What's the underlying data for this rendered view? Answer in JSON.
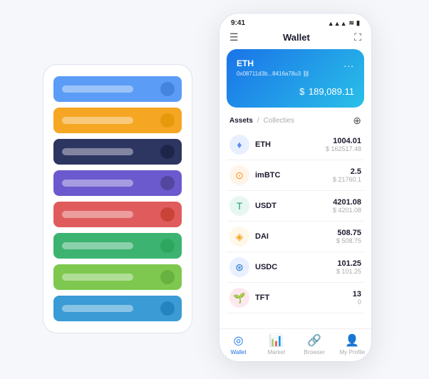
{
  "page": {
    "background": "#f5f7fa"
  },
  "card_stack": {
    "cards": [
      {
        "color": "#5b9cf6",
        "dot_color": "#3a7bd5"
      },
      {
        "color": "#f5a623",
        "dot_color": "#e09400"
      },
      {
        "color": "#2d3561",
        "dot_color": "#1a2040"
      },
      {
        "color": "#6a5acd",
        "dot_color": "#483d8b"
      },
      {
        "color": "#e05c5c",
        "dot_color": "#c0392b"
      },
      {
        "color": "#3cb371",
        "dot_color": "#27a15a"
      },
      {
        "color": "#7ec850",
        "dot_color": "#5fa83a"
      },
      {
        "color": "#3a9bd5",
        "dot_color": "#1a7ab5"
      }
    ]
  },
  "phone": {
    "status_bar": {
      "time": "9:41",
      "signal": "▲▲▲",
      "wifi": "WiFi",
      "battery": "🔋"
    },
    "nav": {
      "menu_icon": "☰",
      "title": "Wallet",
      "scan_icon": "⛶"
    },
    "eth_card": {
      "label": "ETH",
      "dots": "...",
      "address": "0x08711d3b...8416a78u3  ⛓",
      "currency": "$",
      "amount": "189,089.11"
    },
    "assets": {
      "active_tab": "Assets",
      "separator": "/",
      "inactive_tab": "Collecties",
      "add_icon": "⊕",
      "items": [
        {
          "name": "ETH",
          "icon": "♦",
          "icon_bg": "#e8f0ff",
          "icon_color": "#5b8def",
          "amount": "1004.01",
          "usd": "$ 162517.48"
        },
        {
          "name": "imBTC",
          "icon": "⊙",
          "icon_bg": "#fff4e8",
          "icon_color": "#f7931a",
          "amount": "2.5",
          "usd": "$ 21760.1"
        },
        {
          "name": "USDT",
          "icon": "T",
          "icon_bg": "#e6f7f0",
          "icon_color": "#26a17b",
          "amount": "4201.08",
          "usd": "$ 4201.08"
        },
        {
          "name": "DAI",
          "icon": "◈",
          "icon_bg": "#fff8e8",
          "icon_color": "#f5a623",
          "amount": "508.75",
          "usd": "$ 508.75"
        },
        {
          "name": "USDC",
          "icon": "⊛",
          "icon_bg": "#e8f0ff",
          "icon_color": "#2775ca",
          "amount": "101.25",
          "usd": "$ 101.25"
        },
        {
          "name": "TFT",
          "icon": "🌱",
          "icon_bg": "#fde8f0",
          "icon_color": "#e05c8a",
          "amount": "13",
          "usd": "0"
        }
      ]
    },
    "bottom_nav": [
      {
        "label": "Wallet",
        "icon": "◎",
        "active": true
      },
      {
        "label": "Market",
        "icon": "📈",
        "active": false
      },
      {
        "label": "Browser",
        "icon": "👤",
        "active": false
      },
      {
        "label": "My Profile",
        "icon": "👤",
        "active": false
      }
    ]
  }
}
